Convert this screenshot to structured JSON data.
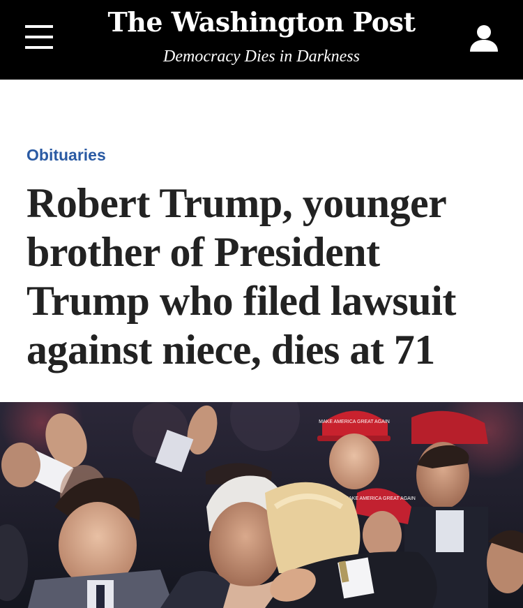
{
  "masthead": {
    "logo_text": "The Washington Post",
    "tagline": "Democracy Dies in Darkness",
    "menu_icon": "hamburger-menu-icon",
    "account_icon": "user-icon",
    "background": "#000000"
  },
  "article": {
    "section": "Obituaries",
    "section_color": "#2a5aa3",
    "headline": "Robert Trump, younger brother of President Trump who filed lawsuit against niece, dies at 71"
  },
  "photo": {
    "hat_text_1": "MAKE AMERICA GREAT AGAIN",
    "hat_text_2": "MAKE AMERICA GREAT AGAIN"
  }
}
